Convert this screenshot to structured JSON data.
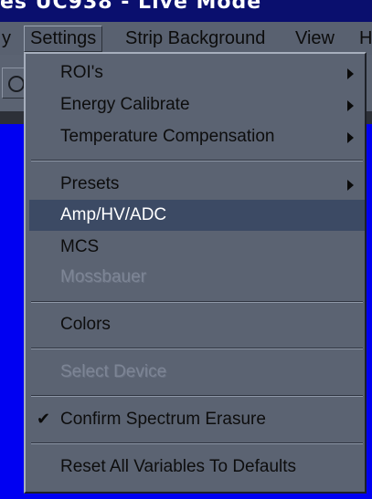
{
  "window": {
    "title": "es   UC938 - Live Mode"
  },
  "menubar": {
    "items": [
      {
        "label": "y"
      },
      {
        "label": "Settings"
      },
      {
        "label": "Strip Background"
      },
      {
        "label": "View"
      },
      {
        "label": "H"
      }
    ]
  },
  "settings_menu": {
    "items": [
      {
        "label": "ROI's",
        "submenu": true,
        "enabled": true
      },
      {
        "label": "Energy Calibrate",
        "submenu": true,
        "enabled": true
      },
      {
        "label": "Temperature Compensation",
        "submenu": true,
        "enabled": true
      },
      {
        "label": "Presets",
        "submenu": true,
        "enabled": true
      },
      {
        "label": "Amp/HV/ADC",
        "submenu": false,
        "enabled": true,
        "highlighted": true
      },
      {
        "label": "MCS",
        "submenu": false,
        "enabled": true
      },
      {
        "label": "Mossbauer",
        "submenu": false,
        "enabled": false
      },
      {
        "label": "Colors",
        "submenu": false,
        "enabled": true
      },
      {
        "label": "Select Device",
        "submenu": false,
        "enabled": false
      },
      {
        "label": "Confirm Spectrum Erasure",
        "submenu": false,
        "enabled": true,
        "checked": true
      },
      {
        "label": "Reset All Variables To Defaults",
        "submenu": false,
        "enabled": true
      }
    ],
    "check_glyph": "✔"
  },
  "colors": {
    "content_background": "#0000f2",
    "menu_background": "#5b6372",
    "highlight": "#3c4a64"
  },
  "icons": {
    "submenu": "submenu-arrow-icon",
    "check": "checkmark-icon",
    "toolbar": "circle-button-icon"
  }
}
